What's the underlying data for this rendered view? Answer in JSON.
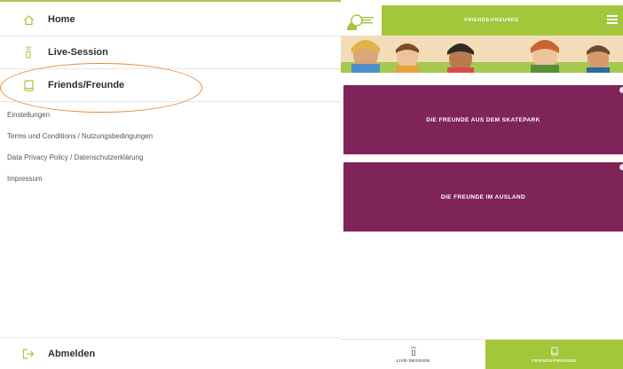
{
  "menu": {
    "items": [
      {
        "label": "Home",
        "icon": "home-icon"
      },
      {
        "label": "Live-Session",
        "icon": "live-session-icon"
      },
      {
        "label": "Friends/Freunde",
        "icon": "book-icon"
      }
    ],
    "links": [
      "Einstellungen",
      "Terms und Conditions / Nutzungsbedingungen",
      "Data Privacy Policy / Datenschutzerklärung",
      "Impressum"
    ],
    "logout": {
      "label": "Abmelden",
      "icon": "logout-icon"
    }
  },
  "app": {
    "logo": "goethe-institut-logo",
    "title": "FRIENDS/FREUNDE",
    "cards": [
      {
        "label": "DIE FREUNDE AUS DEM SKATEPARK"
      },
      {
        "label": "DIE FREUNDE IM AUSLAND"
      }
    ],
    "tabs": [
      {
        "label": "LIVE-SESSION",
        "icon": "live-session-icon"
      },
      {
        "label": "FRIENDS/FREUNDE",
        "icon": "book-icon"
      }
    ]
  },
  "colors": {
    "accent_green": "#a2c73b",
    "card_purple": "#7f2459",
    "highlight_orange": "#ec8a39"
  }
}
